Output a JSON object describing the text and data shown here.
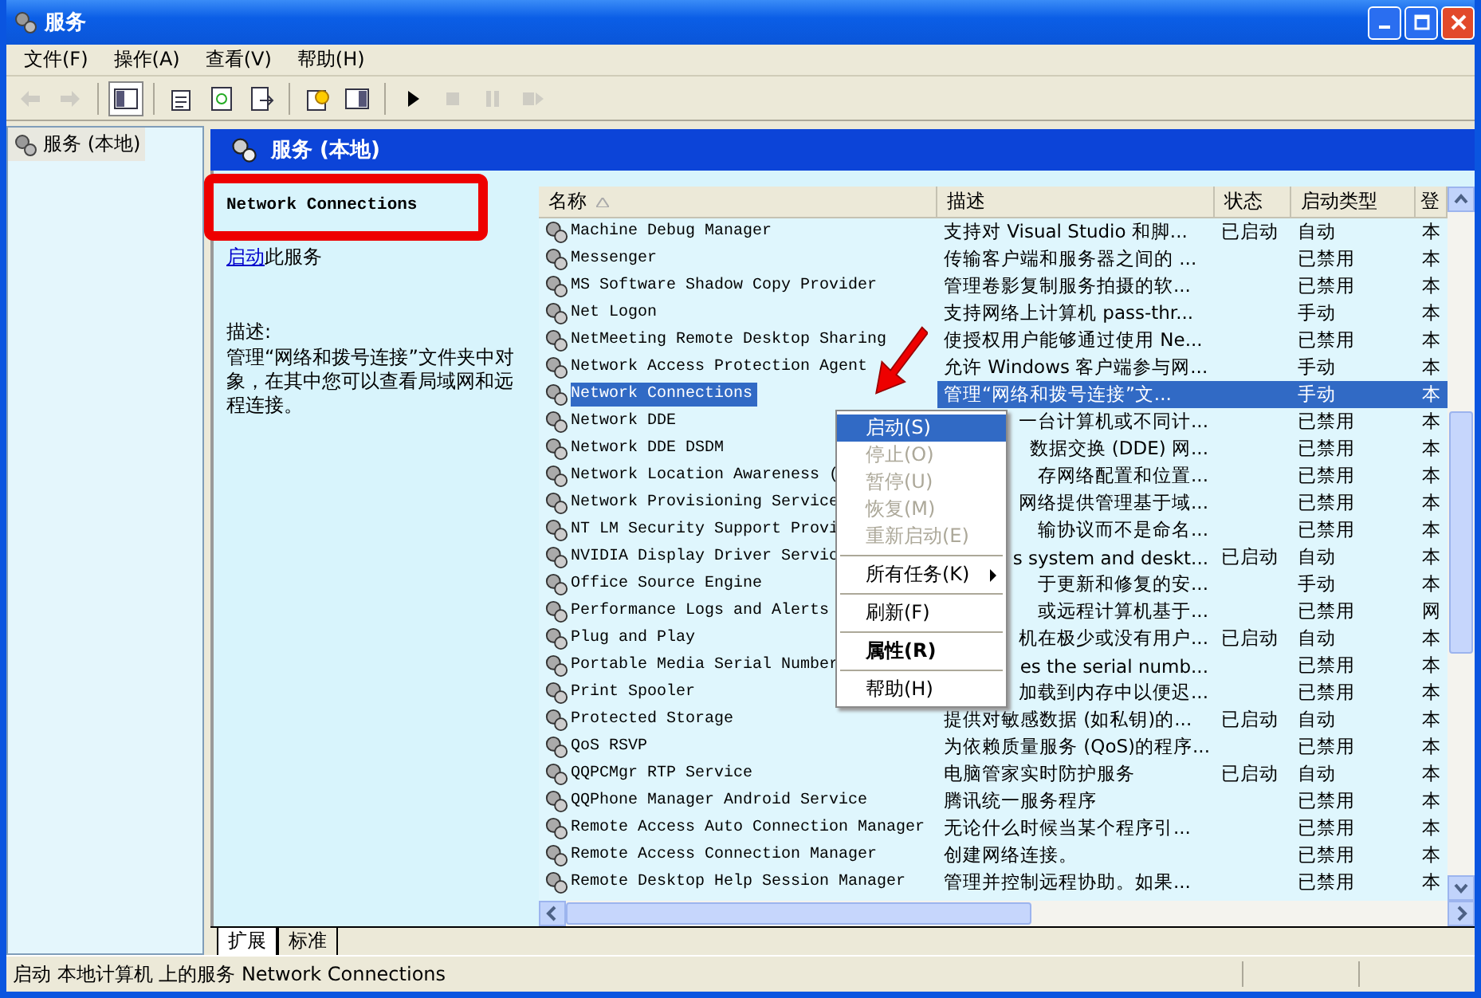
{
  "window": {
    "title": "服务"
  },
  "menu_bar": [
    {
      "label": "文件(F)"
    },
    {
      "label": "操作(A)"
    },
    {
      "label": "查看(V)"
    },
    {
      "label": "帮助(H)"
    }
  ],
  "toolbar": [
    {
      "disabled": true,
      "pressed": false
    },
    {
      "disabled": true,
      "pressed": false
    },
    {
      "disabled": false,
      "pressed": true
    },
    {
      "disabled": false,
      "pressed": false
    },
    {
      "disabled": false,
      "pressed": false
    },
    {
      "disabled": false,
      "pressed": false
    },
    {
      "disabled": false,
      "pressed": false
    },
    {
      "disabled": false,
      "pressed": false
    },
    {
      "disabled": false,
      "pressed": false
    },
    {
      "disabled": true,
      "pressed": false
    },
    {
      "disabled": true,
      "pressed": false
    },
    {
      "disabled": true,
      "pressed": false
    }
  ],
  "tree": {
    "items": [
      {
        "label": "服务 (本地)",
        "selected": true
      }
    ]
  },
  "pane_header": {
    "title": "服务 (本地)"
  },
  "details": {
    "service_name": "Network Connections",
    "action_link": "启动",
    "action_text": "此服务",
    "description_label": "描述:",
    "description": "管理“网络和拨号连接”文件夹中对象，在其中您可以查看局域网和远程连接。"
  },
  "table": {
    "columns": [
      {
        "label": "名称",
        "sorted": true
      },
      {
        "label": "描述",
        "sorted": false
      },
      {
        "label": "状态",
        "sorted": false
      },
      {
        "label": "启动类型",
        "sorted": false
      },
      {
        "label": "登",
        "sorted": false
      }
    ],
    "rows": [
      {
        "name": "Machine Debug Manager",
        "description": "支持对 Visual Studio 和脚...",
        "status": "已启动",
        "startup": "自动",
        "column_5": "本",
        "selected": false,
        "covered": false
      },
      {
        "name": "Messenger",
        "description": "传输客户端和服务器之间的 ...",
        "startup": "已禁用",
        "column_5": "本",
        "selected": false,
        "covered": false
      },
      {
        "name": "MS Software Shadow Copy Provider",
        "description": "管理卷影复制服务拍摄的软...",
        "startup": "已禁用",
        "column_5": "本",
        "selected": false,
        "covered": false
      },
      {
        "name": "Net Logon",
        "description": "支持网络上计算机 pass-thr...",
        "startup": "手动",
        "column_5": "本",
        "selected": false,
        "covered": false
      },
      {
        "name": "NetMeeting Remote Desktop Sharing",
        "description": "使授权用户能够通过使用 Ne...",
        "startup": "已禁用",
        "column_5": "本",
        "selected": false,
        "covered": false
      },
      {
        "name": "Network Access Protection Agent",
        "description": "允许 Windows 客户端参与网...",
        "startup": "手动",
        "column_5": "本",
        "selected": false,
        "covered": false
      },
      {
        "name": "Network Connections",
        "description": "管理“网络和拨号连接”文...",
        "startup": "手动",
        "column_5": "本",
        "selected": true,
        "covered": false
      },
      {
        "name": "Network DDE",
        "description": "一台计算机或不同计...",
        "startup": "已禁用",
        "column_5": "本",
        "selected": false,
        "covered": true
      },
      {
        "name": "Network DDE DSDM",
        "description": "数据交换 (DDE) 网...",
        "startup": "已禁用",
        "column_5": "本",
        "selected": false,
        "covered": true
      },
      {
        "name": "Network Location Awareness (",
        "description": "存网络配置和位置...",
        "startup": "已禁用",
        "column_5": "本",
        "selected": false,
        "covered": true
      },
      {
        "name": "Network Provisioning Service",
        "description": "网络提供管理基于域...",
        "startup": "已禁用",
        "column_5": "本",
        "selected": false,
        "covered": true
      },
      {
        "name": "NT LM Security Support Provi",
        "description": "输协议而不是命名...",
        "startup": "已禁用",
        "column_5": "本",
        "selected": false,
        "covered": true
      },
      {
        "name": "NVIDIA Display Driver Servic",
        "description": "s system and deskt...",
        "status": "已启动",
        "startup": "自动",
        "column_5": "本",
        "selected": false,
        "covered": true
      },
      {
        "name": "Office Source Engine",
        "description": "于更新和修复的安...",
        "startup": "手动",
        "column_5": "本",
        "selected": false,
        "covered": true
      },
      {
        "name": "Performance Logs and Alerts",
        "description": "或远程计算机基于...",
        "startup": "已禁用",
        "column_5": "网",
        "selected": false,
        "covered": true
      },
      {
        "name": "Plug and Play",
        "description": "机在极少或没有用户...",
        "status": "已启动",
        "startup": "自动",
        "column_5": "本",
        "selected": false,
        "covered": true
      },
      {
        "name": "Portable Media Serial Number",
        "description": "es the serial numb...",
        "startup": "已禁用",
        "column_5": "本",
        "selected": false,
        "covered": true
      },
      {
        "name": "Print Spooler",
        "description": "加载到内存中以便迟...",
        "startup": "已禁用",
        "column_5": "本",
        "selected": false,
        "covered": true
      },
      {
        "name": "Protected Storage",
        "description": "提供对敏感数据 (如私钥)的...",
        "status": "已启动",
        "startup": "自动",
        "column_5": "本",
        "selected": false,
        "covered": false
      },
      {
        "name": "QoS RSVP",
        "description": "为依赖质量服务 (QoS)的程序...",
        "startup": "已禁用",
        "column_5": "本",
        "selected": false,
        "covered": false
      },
      {
        "name": "QQPCMgr RTP Service",
        "description": "电脑管家实时防护服务",
        "status": "已启动",
        "startup": "自动",
        "column_5": "本",
        "selected": false,
        "covered": false
      },
      {
        "name": "QQPhone Manager Android Service",
        "description": "腾讯统一服务程序",
        "startup": "已禁用",
        "column_5": "本",
        "selected": false,
        "covered": false
      },
      {
        "name": "Remote Access Auto Connection Manager",
        "description": "无论什么时候当某个程序引...",
        "startup": "已禁用",
        "column_5": "本",
        "selected": false,
        "covered": false
      },
      {
        "name": "Remote Access Connection Manager",
        "description": "创建网络连接。",
        "startup": "已禁用",
        "column_5": "本",
        "selected": false,
        "covered": false
      },
      {
        "name": "Remote Desktop Help Session Manager",
        "description": "管理并控制远程协助。如果...",
        "startup": "已禁用",
        "column_5": "本",
        "selected": false,
        "covered": false
      }
    ]
  },
  "context_menu": {
    "items": [
      {
        "kind": "item",
        "label": "启动(S)",
        "selected": true,
        "disabled": false,
        "bold": false,
        "submenu": false
      },
      {
        "kind": "item",
        "label": "停止(O)",
        "selected": false,
        "disabled": true,
        "bold": false,
        "submenu": false
      },
      {
        "kind": "item",
        "label": "暂停(U)",
        "selected": false,
        "disabled": true,
        "bold": false,
        "submenu": false
      },
      {
        "kind": "item",
        "label": "恢复(M)",
        "selected": false,
        "disabled": true,
        "bold": false,
        "submenu": false
      },
      {
        "kind": "item",
        "label": "重新启动(E)",
        "selected": false,
        "disabled": true,
        "bold": false,
        "submenu": false
      },
      {
        "kind": "separator"
      },
      {
        "kind": "item",
        "label": "所有任务(K)",
        "selected": false,
        "disabled": false,
        "bold": false,
        "submenu": true
      },
      {
        "kind": "separator"
      },
      {
        "kind": "item",
        "label": "刷新(F)",
        "selected": false,
        "disabled": false,
        "bold": false,
        "submenu": false
      },
      {
        "kind": "separator"
      },
      {
        "kind": "item",
        "label": "属性(R)",
        "selected": false,
        "disabled": false,
        "bold": true,
        "submenu": false
      },
      {
        "kind": "separator"
      },
      {
        "kind": "item",
        "label": "帮助(H)",
        "selected": false,
        "disabled": false,
        "bold": false,
        "submenu": false
      }
    ]
  },
  "bottom_tabs": [
    {
      "label": "扩展",
      "selected": true
    },
    {
      "label": "标准",
      "selected": false
    }
  ],
  "status_bar": {
    "text": "启动 本地计算机 上的服务 Network Connections"
  }
}
